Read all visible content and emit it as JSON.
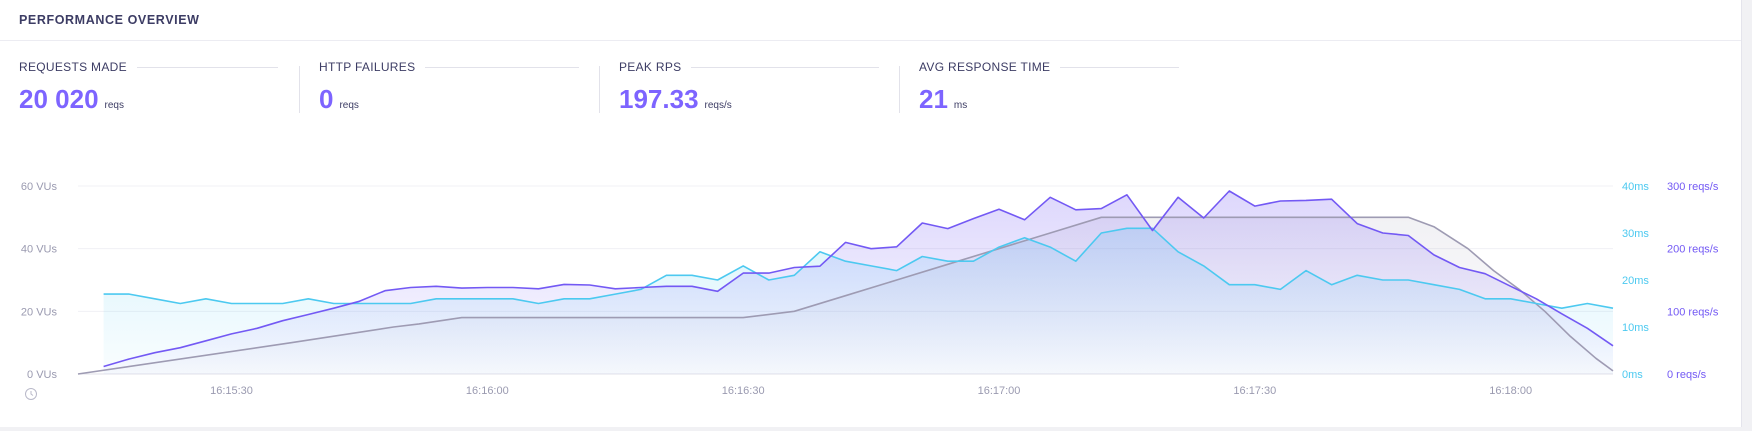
{
  "panel": {
    "title": "PERFORMANCE OVERVIEW"
  },
  "stats": [
    {
      "label": "REQUESTS MADE",
      "value": "20 020",
      "unit": "reqs"
    },
    {
      "label": "HTTP FAILURES",
      "value": "0",
      "unit": "reqs"
    },
    {
      "label": "PEAK RPS",
      "value": "197.33",
      "unit": "reqs/s"
    },
    {
      "label": "AVG RESPONSE TIME",
      "value": "21",
      "unit": "ms"
    }
  ],
  "icons": {
    "time_axis_icon": "clock-icon"
  },
  "colors": {
    "vus": "#9e9bb3",
    "http_req_duration": "#4cc9f0",
    "http_reqs": "#7359f4",
    "accent": "#7d64ff"
  },
  "chart_data": {
    "type": "line",
    "title": "",
    "x_unit": "time",
    "x_range": [
      "16:15:12",
      "16:18:12"
    ],
    "x_ticks": [
      "16:15:30",
      "16:16:00",
      "16:16:30",
      "16:17:00",
      "16:17:30",
      "16:18:00"
    ],
    "y_axes": {
      "left": {
        "unit": "VUs",
        "range": [
          0,
          60
        ],
        "ticks": [
          "0 VUs",
          "20 VUs",
          "40 VUs",
          "60 VUs"
        ]
      },
      "right_ms": {
        "unit": "ms",
        "range": [
          0,
          40
        ],
        "ticks": [
          "0ms",
          "10ms",
          "20ms",
          "30ms",
          "40ms"
        ]
      },
      "right_rps": {
        "unit": "reqs/s",
        "range": [
          0,
          300
        ],
        "ticks": [
          "0 reqs/s",
          "100 reqs/s",
          "200 reqs/s",
          "300 reqs/s"
        ]
      }
    },
    "grid": true,
    "legend": "none",
    "series": [
      {
        "axis": "left",
        "x": [
          "16:15:12",
          "16:15:37",
          "16:15:49",
          "16:15:52",
          "16:15:57",
          "16:16:00",
          "16:16:30",
          "16:16:36",
          "16:16:42",
          "16:16:48",
          "16:16:54",
          "16:17:06",
          "16:17:12",
          "16:17:36",
          "16:17:42",
          "16:17:48",
          "16:17:51",
          "16:17:55",
          "16:17:58",
          "16:18:01",
          "16:18:04",
          "16:18:07",
          "16:18:10",
          "16:18:12"
        ],
        "y": [
          0,
          10,
          15,
          16,
          18,
          18,
          18,
          20,
          25,
          30,
          35,
          45,
          50,
          50,
          50,
          50,
          47,
          40,
          33,
          27,
          20,
          12,
          5,
          1
        ]
      },
      {
        "axis": "right_ms",
        "x": [
          "16:15:15",
          "16:15:18",
          "16:15:21",
          "16:15:24",
          "16:15:27",
          "16:15:30",
          "16:15:33",
          "16:15:36",
          "16:15:39",
          "16:15:42",
          "16:15:45",
          "16:15:48",
          "16:15:51",
          "16:15:54",
          "16:15:57",
          "16:16:00",
          "16:16:03",
          "16:16:06",
          "16:16:09",
          "16:16:12",
          "16:16:15",
          "16:16:18",
          "16:16:21",
          "16:16:24",
          "16:16:27",
          "16:16:30",
          "16:16:33",
          "16:16:36",
          "16:16:39",
          "16:16:42",
          "16:16:45",
          "16:16:48",
          "16:16:51",
          "16:16:54",
          "16:16:57",
          "16:17:00",
          "16:17:03",
          "16:17:06",
          "16:17:09",
          "16:17:12",
          "16:17:15",
          "16:17:18",
          "16:17:21",
          "16:17:24",
          "16:17:27",
          "16:17:30",
          "16:17:33",
          "16:17:36",
          "16:17:39",
          "16:17:42",
          "16:17:45",
          "16:17:48",
          "16:17:51",
          "16:17:54",
          "16:17:57",
          "16:18:00",
          "16:18:03",
          "16:18:06",
          "16:18:09",
          "16:18:12"
        ],
        "y": [
          17,
          17,
          16,
          15,
          16,
          15,
          15,
          15,
          16,
          15,
          15,
          15,
          15,
          16,
          16,
          16,
          16,
          15,
          16,
          16,
          17,
          18,
          21,
          21,
          20,
          23,
          20,
          21,
          26,
          24,
          23,
          22,
          25,
          24,
          24,
          27,
          29,
          27,
          24,
          30,
          31,
          31,
          26,
          23,
          19,
          19,
          18,
          22,
          19,
          21,
          20,
          20,
          19,
          18,
          16,
          16,
          15,
          14,
          15,
          14
        ]
      },
      {
        "axis": "right_rps",
        "x": [
          "16:15:15",
          "16:15:18",
          "16:15:21",
          "16:15:24",
          "16:15:27",
          "16:15:30",
          "16:15:33",
          "16:15:36",
          "16:15:39",
          "16:15:42",
          "16:15:45",
          "16:15:48",
          "16:15:51",
          "16:15:54",
          "16:15:57",
          "16:16:00",
          "16:16:03",
          "16:16:06",
          "16:16:09",
          "16:16:12",
          "16:16:15",
          "16:16:18",
          "16:16:21",
          "16:16:24",
          "16:16:27",
          "16:16:30",
          "16:16:33",
          "16:16:36",
          "16:16:39",
          "16:16:42",
          "16:16:45",
          "16:16:48",
          "16:16:51",
          "16:16:54",
          "16:16:57",
          "16:17:00",
          "16:17:03",
          "16:17:06",
          "16:17:09",
          "16:17:12",
          "16:17:15",
          "16:17:18",
          "16:17:21",
          "16:17:24",
          "16:17:27",
          "16:17:30",
          "16:17:33",
          "16:17:36",
          "16:17:39",
          "16:17:42",
          "16:17:45",
          "16:17:48",
          "16:17:51",
          "16:17:54",
          "16:17:57",
          "16:18:00",
          "16:18:03",
          "16:18:06",
          "16:18:09",
          "16:18:12"
        ],
        "y": [
          12,
          24,
          34,
          42,
          53,
          64,
          73,
          85,
          95,
          105,
          116,
          133,
          138,
          140,
          137,
          138,
          138,
          136,
          143,
          142,
          136,
          138,
          140,
          140,
          132,
          161,
          161,
          170,
          172,
          210,
          200,
          203,
          241,
          232,
          248,
          263,
          246,
          282,
          262,
          264,
          286,
          229,
          282,
          249,
          292,
          268,
          276,
          277,
          279,
          240,
          225,
          221,
          190,
          170,
          160,
          140,
          120,
          96,
          73,
          45
        ]
      }
    ]
  }
}
